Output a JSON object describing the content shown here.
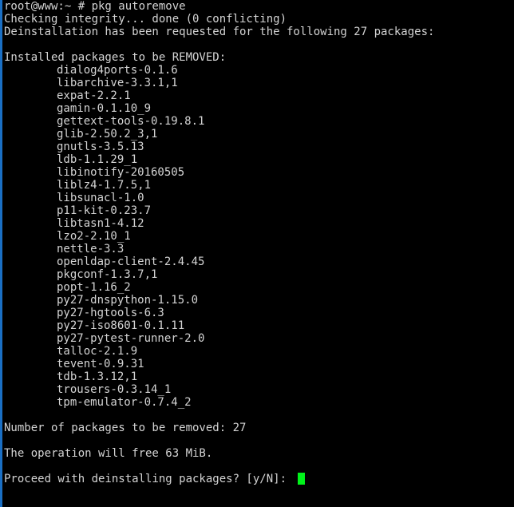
{
  "terminal": {
    "background_color": "#000000",
    "foreground_color": "#d4d4d4",
    "cursor_color": "#00f21a",
    "edge_accent_color": "#1a6fc4",
    "shell_prompt": "root@www:~ # ",
    "command": "pkg autoremove",
    "command_line": "root@www:~ # pkg autoremove",
    "output": {
      "integrity_line": "Checking integrity... done (0 conflicting)",
      "deinstallation_line": "Deinstallation has been requested for the following 27 packages:",
      "removed_header": "Installed packages to be REMOVED:",
      "packages": [
        "dialog4ports-0.1.6",
        "libarchive-3.3.1,1",
        "expat-2.2.1",
        "gamin-0.1.10_9",
        "gettext-tools-0.19.8.1",
        "glib-2.50.2_3,1",
        "gnutls-3.5.13",
        "ldb-1.1.29_1",
        "libinotify-20160505",
        "liblz4-1.7.5,1",
        "libsunacl-1.0",
        "p11-kit-0.23.7",
        "libtasn1-4.12",
        "lzo2-2.10_1",
        "nettle-3.3",
        "openldap-client-2.4.45",
        "pkgconf-1.3.7,1",
        "popt-1.16_2",
        "py27-dnspython-1.15.0",
        "py27-hgtools-6.3",
        "py27-iso8601-0.1.11",
        "py27-pytest-runner-2.0",
        "talloc-2.1.9",
        "tevent-0.9.31",
        "tdb-1.3.12,1",
        "trousers-0.3.14_1",
        "tpm-emulator-0.7.4_2"
      ],
      "count_line": "Number of packages to be removed: 27",
      "free_space_line": "The operation will free 63 MiB.",
      "confirm_prompt": "Proceed with deinstalling packages? [y/N]: ",
      "package_count": 27,
      "freed_space": "63 MiB",
      "conflicting_count": 0
    }
  }
}
